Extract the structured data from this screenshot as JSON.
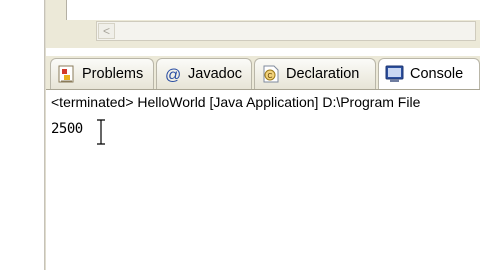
{
  "views": {
    "tabs": [
      {
        "label": "Problems",
        "icon": "problems-icon"
      },
      {
        "label": "Javadoc",
        "icon": "at-icon"
      },
      {
        "label": "Declaration",
        "icon": "declaration-icon"
      },
      {
        "label": "Console",
        "icon": "console-icon"
      }
    ],
    "active_tab": "Console"
  },
  "console": {
    "status_line": "<terminated> HelloWorld [Java Application] D:\\Program File",
    "output": "2500"
  },
  "colors": {
    "chrome": "#ece9d8",
    "active_tab": "#ffffff",
    "border": "#a9a594"
  }
}
